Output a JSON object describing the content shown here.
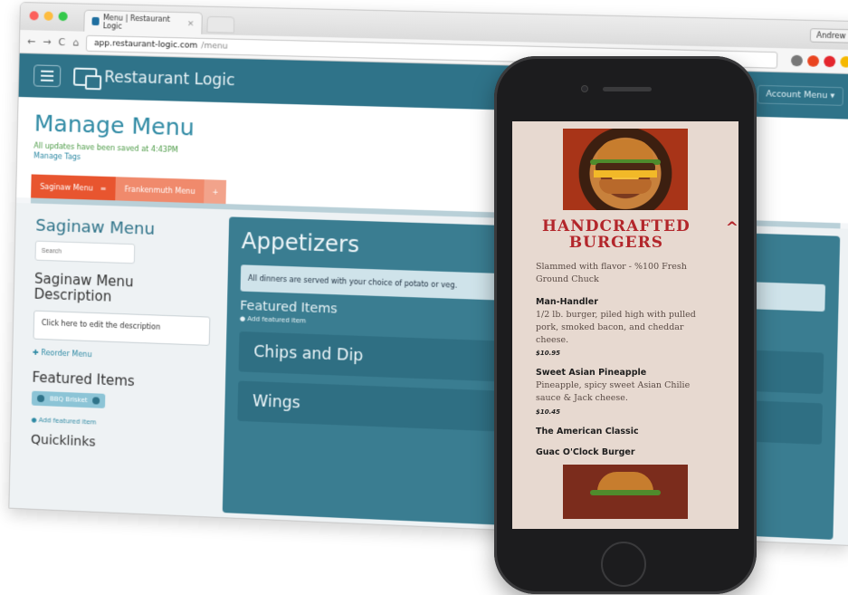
{
  "browser": {
    "tab_title": "Menu | Restaurant Logic",
    "tab_close": "×",
    "user": "Andrew",
    "url_host": "app.restaurant-logic.com",
    "url_path": "/menu"
  },
  "app": {
    "brand": "Restaurant Logic",
    "account_menu": "Account Menu ▾"
  },
  "page": {
    "title": "Manage Menu",
    "saved_status": "All updates have been saved at 4:43PM",
    "manage_tags": "Manage Tags"
  },
  "menu_tabs": [
    {
      "label": "Saginaw Menu",
      "icon": "≡"
    },
    {
      "label": "Frankenmuth Menu"
    },
    {
      "label": "+"
    }
  ],
  "left": {
    "menu_name": "Saginaw Menu",
    "search_placeholder": "Search",
    "desc_heading": "Saginaw Menu Description",
    "desc_box": "Click here to edit the description",
    "reorder": "✚ Reorder Menu",
    "featured_heading": "Featured Items",
    "featured_chip": "BBQ Brisket",
    "add_featured": "Add featured item",
    "quicklinks": "Quicklinks"
  },
  "right": {
    "category_title": "Appetizers",
    "note": "All dinners are served with your choice of potato or veg.",
    "featured_heading": "Featured Items",
    "add_featured": "Add featured item",
    "subcategories": [
      "Chips and Dip",
      "Wings"
    ]
  },
  "phone": {
    "heading": "HANDCRAFTED BURGERS",
    "chevron": "^",
    "tagline": "Slammed with flavor - %100 Fresh Ground Chuck",
    "items": [
      {
        "name": "Man-Handler",
        "desc": "1/2 lb. burger, piled high with pulled pork, smoked bacon, and cheddar cheese.",
        "price": "$10.95"
      },
      {
        "name": "Sweet Asian Pineapple",
        "desc": "Pineapple, spicy sweet Asian Chilie sauce & Jack cheese.",
        "price": "$10.45"
      },
      {
        "name": "The American Classic",
        "desc": "",
        "price": ""
      },
      {
        "name": "Guac O'Clock Burger",
        "desc": "",
        "price": ""
      }
    ]
  },
  "colors": {
    "nav": "#2f7389",
    "accent_orange": "#e8552f",
    "menu_red": "#b3262b",
    "phone_bg": "#e7d9d0"
  }
}
